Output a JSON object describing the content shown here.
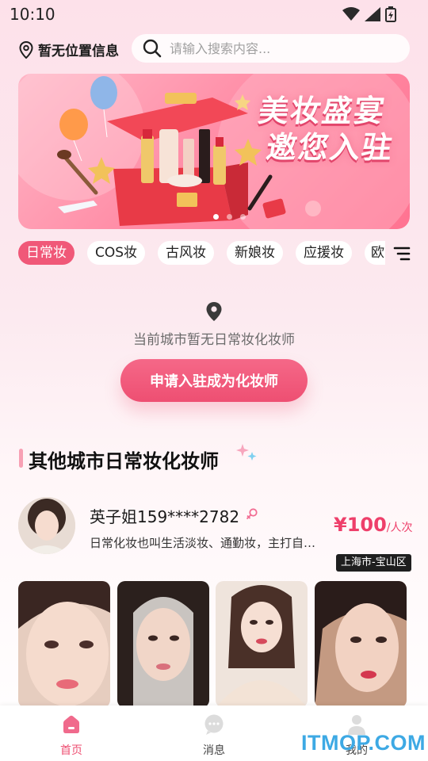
{
  "status_bar": {
    "time": "10:10"
  },
  "header": {
    "location_text": "暂无位置信息",
    "search_placeholder": "请输入搜索内容..."
  },
  "banner": {
    "title_line1": "美妆盛宴",
    "title_line2": "邀您入驻",
    "slide_count": 3,
    "active_slide": 1
  },
  "tabs": [
    {
      "label": "日常妆",
      "active": true
    },
    {
      "label": "COS妆",
      "active": false
    },
    {
      "label": "古风妆",
      "active": false
    },
    {
      "label": "新娘妆",
      "active": false
    },
    {
      "label": "应援妆",
      "active": false
    },
    {
      "label": "欧",
      "active": false
    }
  ],
  "empty_state": {
    "message": "当前城市暂无日常妆化妆师",
    "apply_button": "申请入驻成为化妆师"
  },
  "section": {
    "title": "其他城市日常妆化妆师"
  },
  "artist": {
    "name": "英子姐159****2782",
    "description": "日常化妆也叫生活淡妆、通勤妆，主打自…",
    "price": "¥100",
    "price_unit": "/人次",
    "location": "上海市-宝山区"
  },
  "bottom_nav": [
    {
      "label": "首页",
      "icon": "home-icon",
      "active": true
    },
    {
      "label": "消息",
      "icon": "message-icon",
      "active": false
    },
    {
      "label": "我的",
      "icon": "profile-icon",
      "active": false
    }
  ],
  "watermark": "ITMOP.COM",
  "colors": {
    "accent": "#ee4f72",
    "price": "#ee3f6a",
    "tag_dark": "#1f1f1f"
  }
}
